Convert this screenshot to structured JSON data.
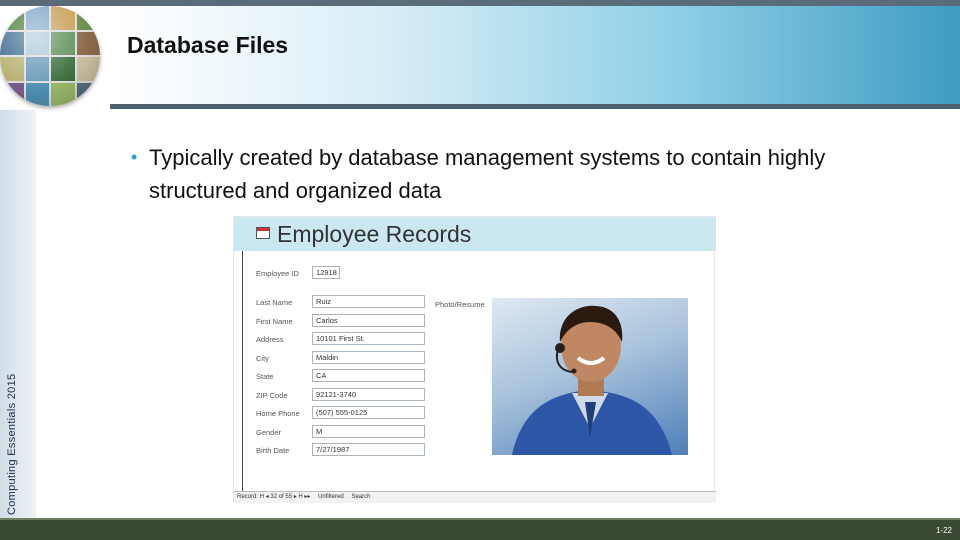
{
  "slide": {
    "title": "Database Files",
    "side_label": "Computing Essentials 2015",
    "bullet": "Typically created by database management systems to contain highly structured and organized data",
    "slide_number": "1-22"
  },
  "form": {
    "title": "Employee Records",
    "fields": [
      {
        "label": "Employee ID",
        "value": "12918"
      },
      {
        "label": "Last Name",
        "value": "Ruiz"
      },
      {
        "label": "First Name",
        "value": "Carlos"
      },
      {
        "label": "Address",
        "value": "10101 First St."
      },
      {
        "label": "City",
        "value": "Maldin"
      },
      {
        "label": "State",
        "value": "CA"
      },
      {
        "label": "ZIP Code",
        "value": "92121-3740"
      },
      {
        "label": "Home Phone",
        "value": "(507) 555-0125"
      },
      {
        "label": "Gender",
        "value": "M"
      },
      {
        "label": "Birth Date",
        "value": "7/27/1987"
      }
    ],
    "photo_label": "Photo/Resume",
    "footer": {
      "record": "Record: H  ◂  32 of 55  ▸  H  ▸▸",
      "filter": "Unfiltered",
      "search": "Search"
    }
  },
  "colors": {
    "bullet": "#2e9fcf",
    "header_accent": "#3f9cc2",
    "bottom_bar": "#3a4a33"
  }
}
